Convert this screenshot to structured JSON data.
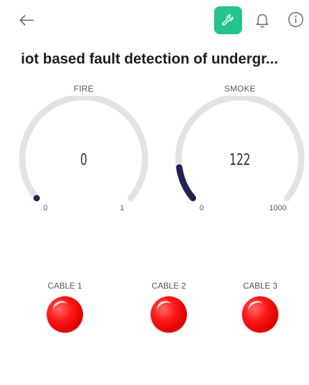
{
  "header": {
    "title": "iot based fault detection of undergr...",
    "back_icon": "arrow-left-icon",
    "settings_icon": "wrench-icon",
    "notifications_icon": "bell-icon",
    "info_icon": "info-icon",
    "accent_color": "#23c48e"
  },
  "gauges": [
    {
      "label": "FIRE",
      "value": "0",
      "min": "0",
      "max": "1",
      "fraction": 0.0,
      "color": "#1f2451"
    },
    {
      "label": "SMOKE",
      "value": "122",
      "min": "0",
      "max": "1000",
      "fraction": 0.122,
      "color": "#1f2451"
    }
  ],
  "leds": [
    {
      "label": "CABLE 1",
      "color": "#ff0000"
    },
    {
      "label": "CABLE 2",
      "color": "#ff0000"
    },
    {
      "label": "CABLE 3",
      "color": "#ff0000"
    }
  ]
}
